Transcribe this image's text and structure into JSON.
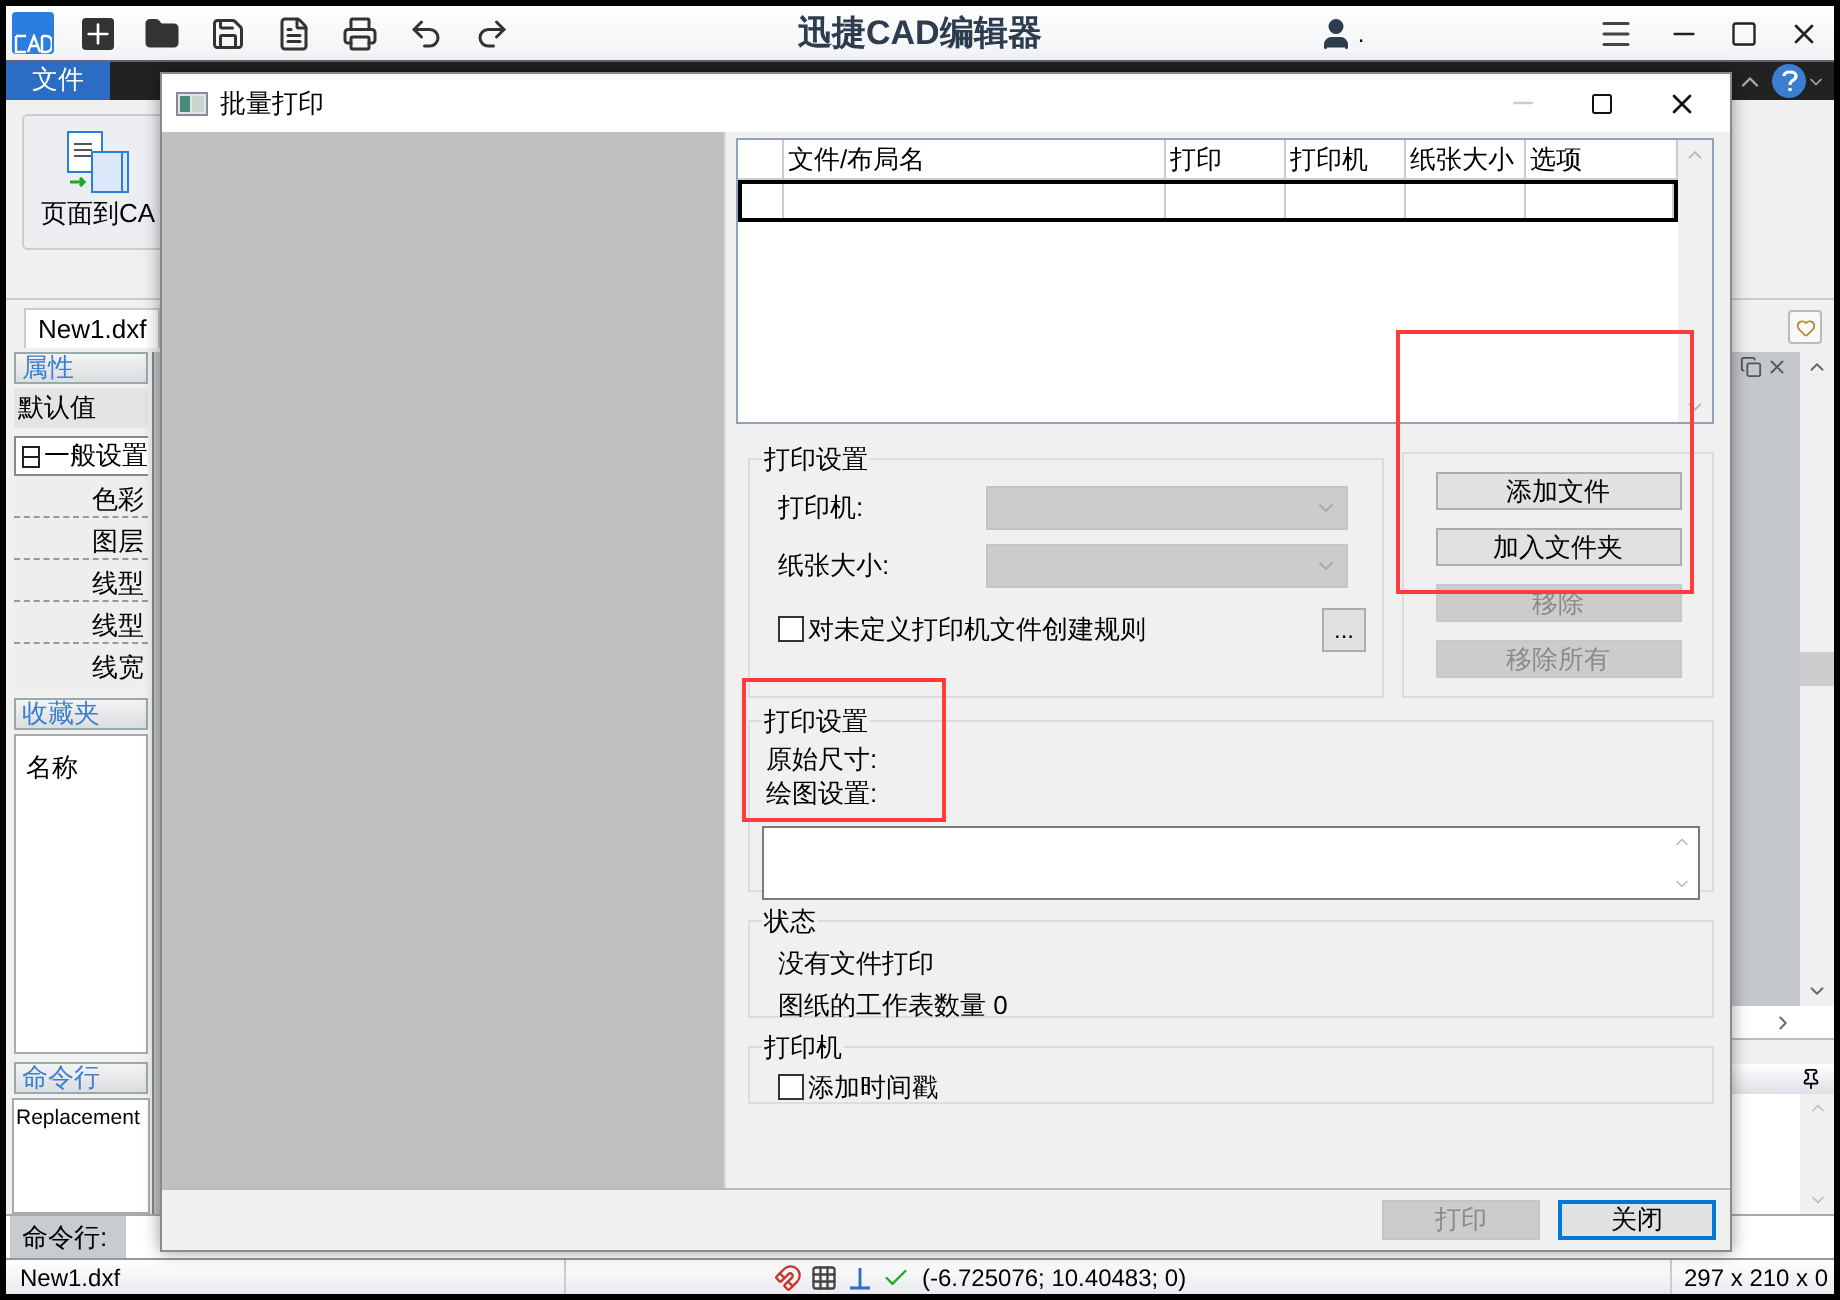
{
  "app": {
    "title": "迅捷CAD编辑器",
    "user": ".",
    "menu_tabs": [
      {
        "label": "文件",
        "selected": true
      }
    ],
    "ribbon_button": "页面到CA",
    "doc_tab": {
      "label": "New1.dxf",
      "selected": true
    }
  },
  "properties_panel": {
    "title": "属性",
    "default": "默认值",
    "tree": [
      {
        "label": "一般设置",
        "expanded": true,
        "children": [
          {
            "label": "色彩"
          },
          {
            "label": "图层"
          },
          {
            "label": "线型"
          },
          {
            "label": "线型"
          },
          {
            "label": "线宽"
          }
        ]
      }
    ]
  },
  "favorites_panel": {
    "title": "收藏夹",
    "column": "名称"
  },
  "command_panel": {
    "title": "命令行",
    "output": "Replacement",
    "prompt": "命令行:"
  },
  "status_bar": {
    "file": "New1.dxf",
    "coordinates": "(-6.725076; 10.40483; 0)",
    "paper": "297 x 210 x 0"
  },
  "dialog": {
    "title": "批量打印",
    "table": {
      "columns": [
        "文件/布局名",
        "打印",
        "打印机",
        "纸张大小",
        "选项"
      ],
      "rows": [
        {
          "selected": true
        }
      ]
    },
    "print_settings": {
      "title": "打印设置",
      "fields": [
        {
          "label": "打印机:",
          "disabled": true
        },
        {
          "label": "纸张大小:",
          "disabled": true
        }
      ],
      "rule_checkbox": {
        "label": "对未定义打印机文件创建规则",
        "checked": false
      },
      "more_button": "..."
    },
    "file_buttons": [
      {
        "label": "添加文件",
        "disabled": false
      },
      {
        "label": "加入文件夹",
        "disabled": false
      },
      {
        "label": "移除",
        "disabled": true
      },
      {
        "label": "移除所有",
        "disabled": true
      }
    ],
    "plot_settings": {
      "title": "打印设置",
      "lines": [
        "原始尺寸:",
        "绘图设置:"
      ]
    },
    "status": {
      "title": "状态",
      "lines": [
        "没有文件打印",
        "图纸的工作表数量 0"
      ]
    },
    "printer": {
      "title": "打印机",
      "timestamp_checkbox": {
        "label": "添加时间戳",
        "checked": false
      }
    },
    "footer_buttons": [
      {
        "label": "打印",
        "disabled": true,
        "focused": false
      },
      {
        "label": "关闭",
        "disabled": false,
        "focused": true
      }
    ]
  }
}
